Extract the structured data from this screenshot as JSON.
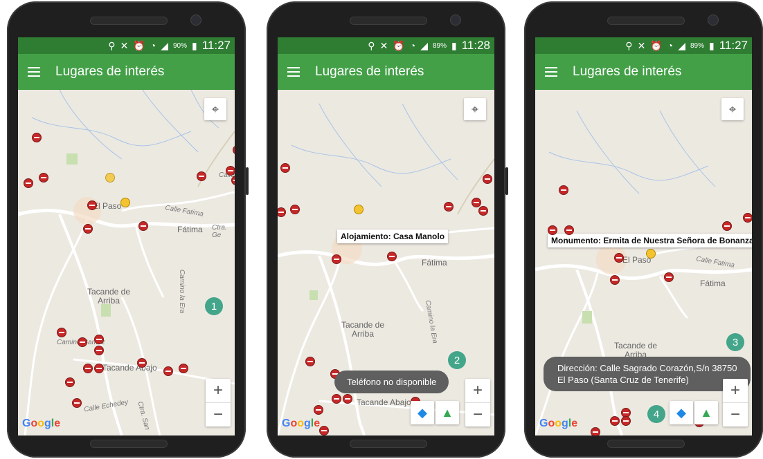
{
  "phones": [
    {
      "status": {
        "battery": "90%",
        "time": "11:27"
      },
      "title": "Lugares de interés",
      "labels": {
        "el_paso": "El Paso",
        "fatima": "Fátima",
        "tacande_arriba": "Tacande de Arriba",
        "tacande_abajo": "Tacande Abajo",
        "camino_la_era": "Camino la Era",
        "calle_fatima": "Calle Fatima",
        "ctra_ge": "Ctra. Ge",
        "calle_echedey": "Calle Echedey",
        "camino_gamez": "Camino Gamez",
        "calle": "Calle",
        "ctra_san": "Ctra. San"
      },
      "badge": "1",
      "google": "Google",
      "zoom": {
        "plus": "+",
        "minus": "−"
      }
    },
    {
      "status": {
        "battery": "89%",
        "time": "11:28"
      },
      "title": "Lugares de interés",
      "labels": {
        "fatima": "Fátima",
        "tacande_arriba": "Tacande de Arriba",
        "tacande_abajo": "Tacande Abajo",
        "camino_la_era": "Camino la Era"
      },
      "infowindow": "Alojamiento: Casa Manolo",
      "toast": "Teléfono no disponible",
      "badge": "2",
      "google": "Google",
      "zoom": {
        "plus": "+",
        "minus": "−"
      }
    },
    {
      "status": {
        "battery": "89%",
        "time": "11:27"
      },
      "title": "Lugares de interés",
      "labels": {
        "el_paso": "El Paso",
        "fatima": "Fátima",
        "tacande_arriba": "Tacande de Arriba",
        "calle_fatima": "Calle Fatima"
      },
      "infowindow": "Monumento: Ermita de Nuestra Señora de Bonanza",
      "toast_line1": "Dirección: Calle Sagrado Corazón,S/n 38750",
      "toast_line2": "El Paso (Santa Cruz de Tenerife)",
      "badge3": "3",
      "badge4": "4",
      "google": "Google",
      "zoom": {
        "plus": "+",
        "minus": "−"
      }
    }
  ],
  "icons": {
    "menu": "menu-icon",
    "location": "my-location-icon",
    "directions": "directions-icon",
    "maps": "google-maps-icon",
    "restaurant": "restaurant-icon",
    "accommodation": "accommodation-icon"
  },
  "colors": {
    "status_bar": "#2e7d32",
    "app_bar": "#43a047",
    "pin": "#c62828",
    "badge": "#43a58a",
    "toast": "#5f5f5f"
  }
}
